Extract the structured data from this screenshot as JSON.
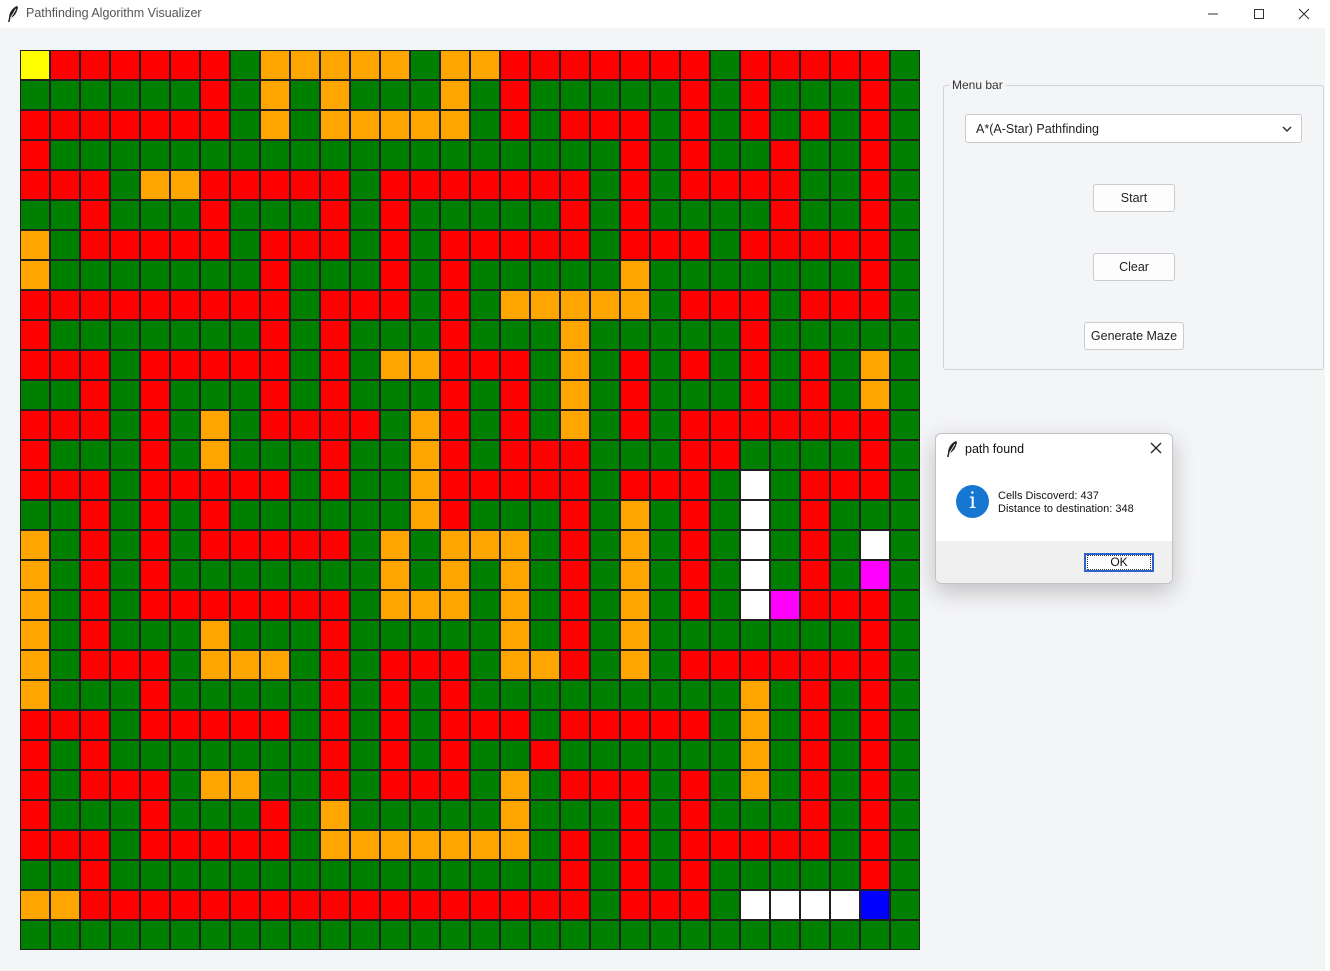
{
  "window": {
    "title": "Pathfinding Algorithm Visualizer"
  },
  "colors": {
    "wall": "#ff0000",
    "open": "#008000",
    "visited": "#ffa500",
    "path": "#ffffff",
    "start": "#ffff00",
    "end": "#0000ff",
    "frontier": "#ff00ff"
  },
  "grid_legend": {
    "R": "wall",
    "G": "open",
    "O": "visited",
    "W": "path",
    "Y": "start",
    "B": "end",
    "M": "frontier"
  },
  "grid": [
    "YRRRRRRGOOOOOGOORRRRRRRGRRRRRG",
    "GGGGGGRGOGOGGGOGRGGGGGRGRGGGRG",
    "RRRRRRRGOGOOOOOGRGRRRGRGRGRGRG",
    "RGGGGGGGGGGGGGGGGGGGRGRGGRGGRG",
    "RRRGOORRRRRGRRRRRRRGRGRRRRGGRG",
    "GGRGGGRGGGRGRGGGGGRGRGGGGRGGRG",
    "OGRRRRRGRRRGRGRRRRRGRRRGRRRRRG",
    "OGGGGGGGRGGGRGRGGGGGOGGGGGGGRG",
    "RRRRRRRRRGRRRGRGOOOOOGRRRGRRRG",
    "RGGGGGGGRGRGGGRGGGOGGGGGRGGGGG",
    "RRRGRRRRRGRGOORRRGOGRGRGRGRGOG",
    "GGRGRGGGRGRGGGRGRGOGRGGGRGRGOG",
    "RRRGRGOGRRRRGORGRGOGRGRRRRRRRG",
    "RGGGRGOGGGRGGORGRRRGGGRRGGGGRG",
    "RRRGRRRRRGRGGORRRRRGRRRGWGRRRG",
    "GGRGRGRGGGGGGORGGGRGOGRGWGRGGG",
    "OGRGRGRRRRRGOGOOOGRGOGRGWGRGWG",
    "OGRGRGGGGGGGOGOGOGRGOGRGWGRGMG",
    "OGRGRRRRRRRGOOOGOGRGOGRGWMRRRG",
    "OGRGGGOGGGRGGGGGOGRGOGGGGGGGRG",
    "OGRRRGOOOGRGRRRGOORGOGRRRRRRRG",
    "OGGGRGGGGGRGRGRGGGGGGGGGOGRGRG",
    "RRRGRRRRRGRGRGRRRGRRRRRGOGRGRG",
    "RGRGGGGGGGRGRGRGGRGGGGGGOGRGRG",
    "RGRRRGOOGGRGRRRGOGRRRGRGOGRGRG",
    "RGGGRGGGRGOGGGGGOGGGRGRGGGRGRG",
    "RRRGRRRRRGOOOOOOOGRGRGRRRRRGRG",
    "GGRGGGGGGGGGGGGGGGRGRGRGGGGGRG",
    "OORRRRRRRRRRRRRRRRRGRRRGWWWWBG",
    "GGGGGGGGGGGGGGGGGGGGGGGGGGGGGG"
  ],
  "menu": {
    "legend": "Menu bar",
    "algorithm_selected": "A*(A-Star) Pathfinding",
    "start_label": "Start",
    "clear_label": "Clear",
    "generate_label": "Generate Maze"
  },
  "dialog": {
    "title": "path found",
    "line1": "Cells Discoverd: 437",
    "line2": "Distance to destination: 348",
    "ok_label": "OK"
  }
}
